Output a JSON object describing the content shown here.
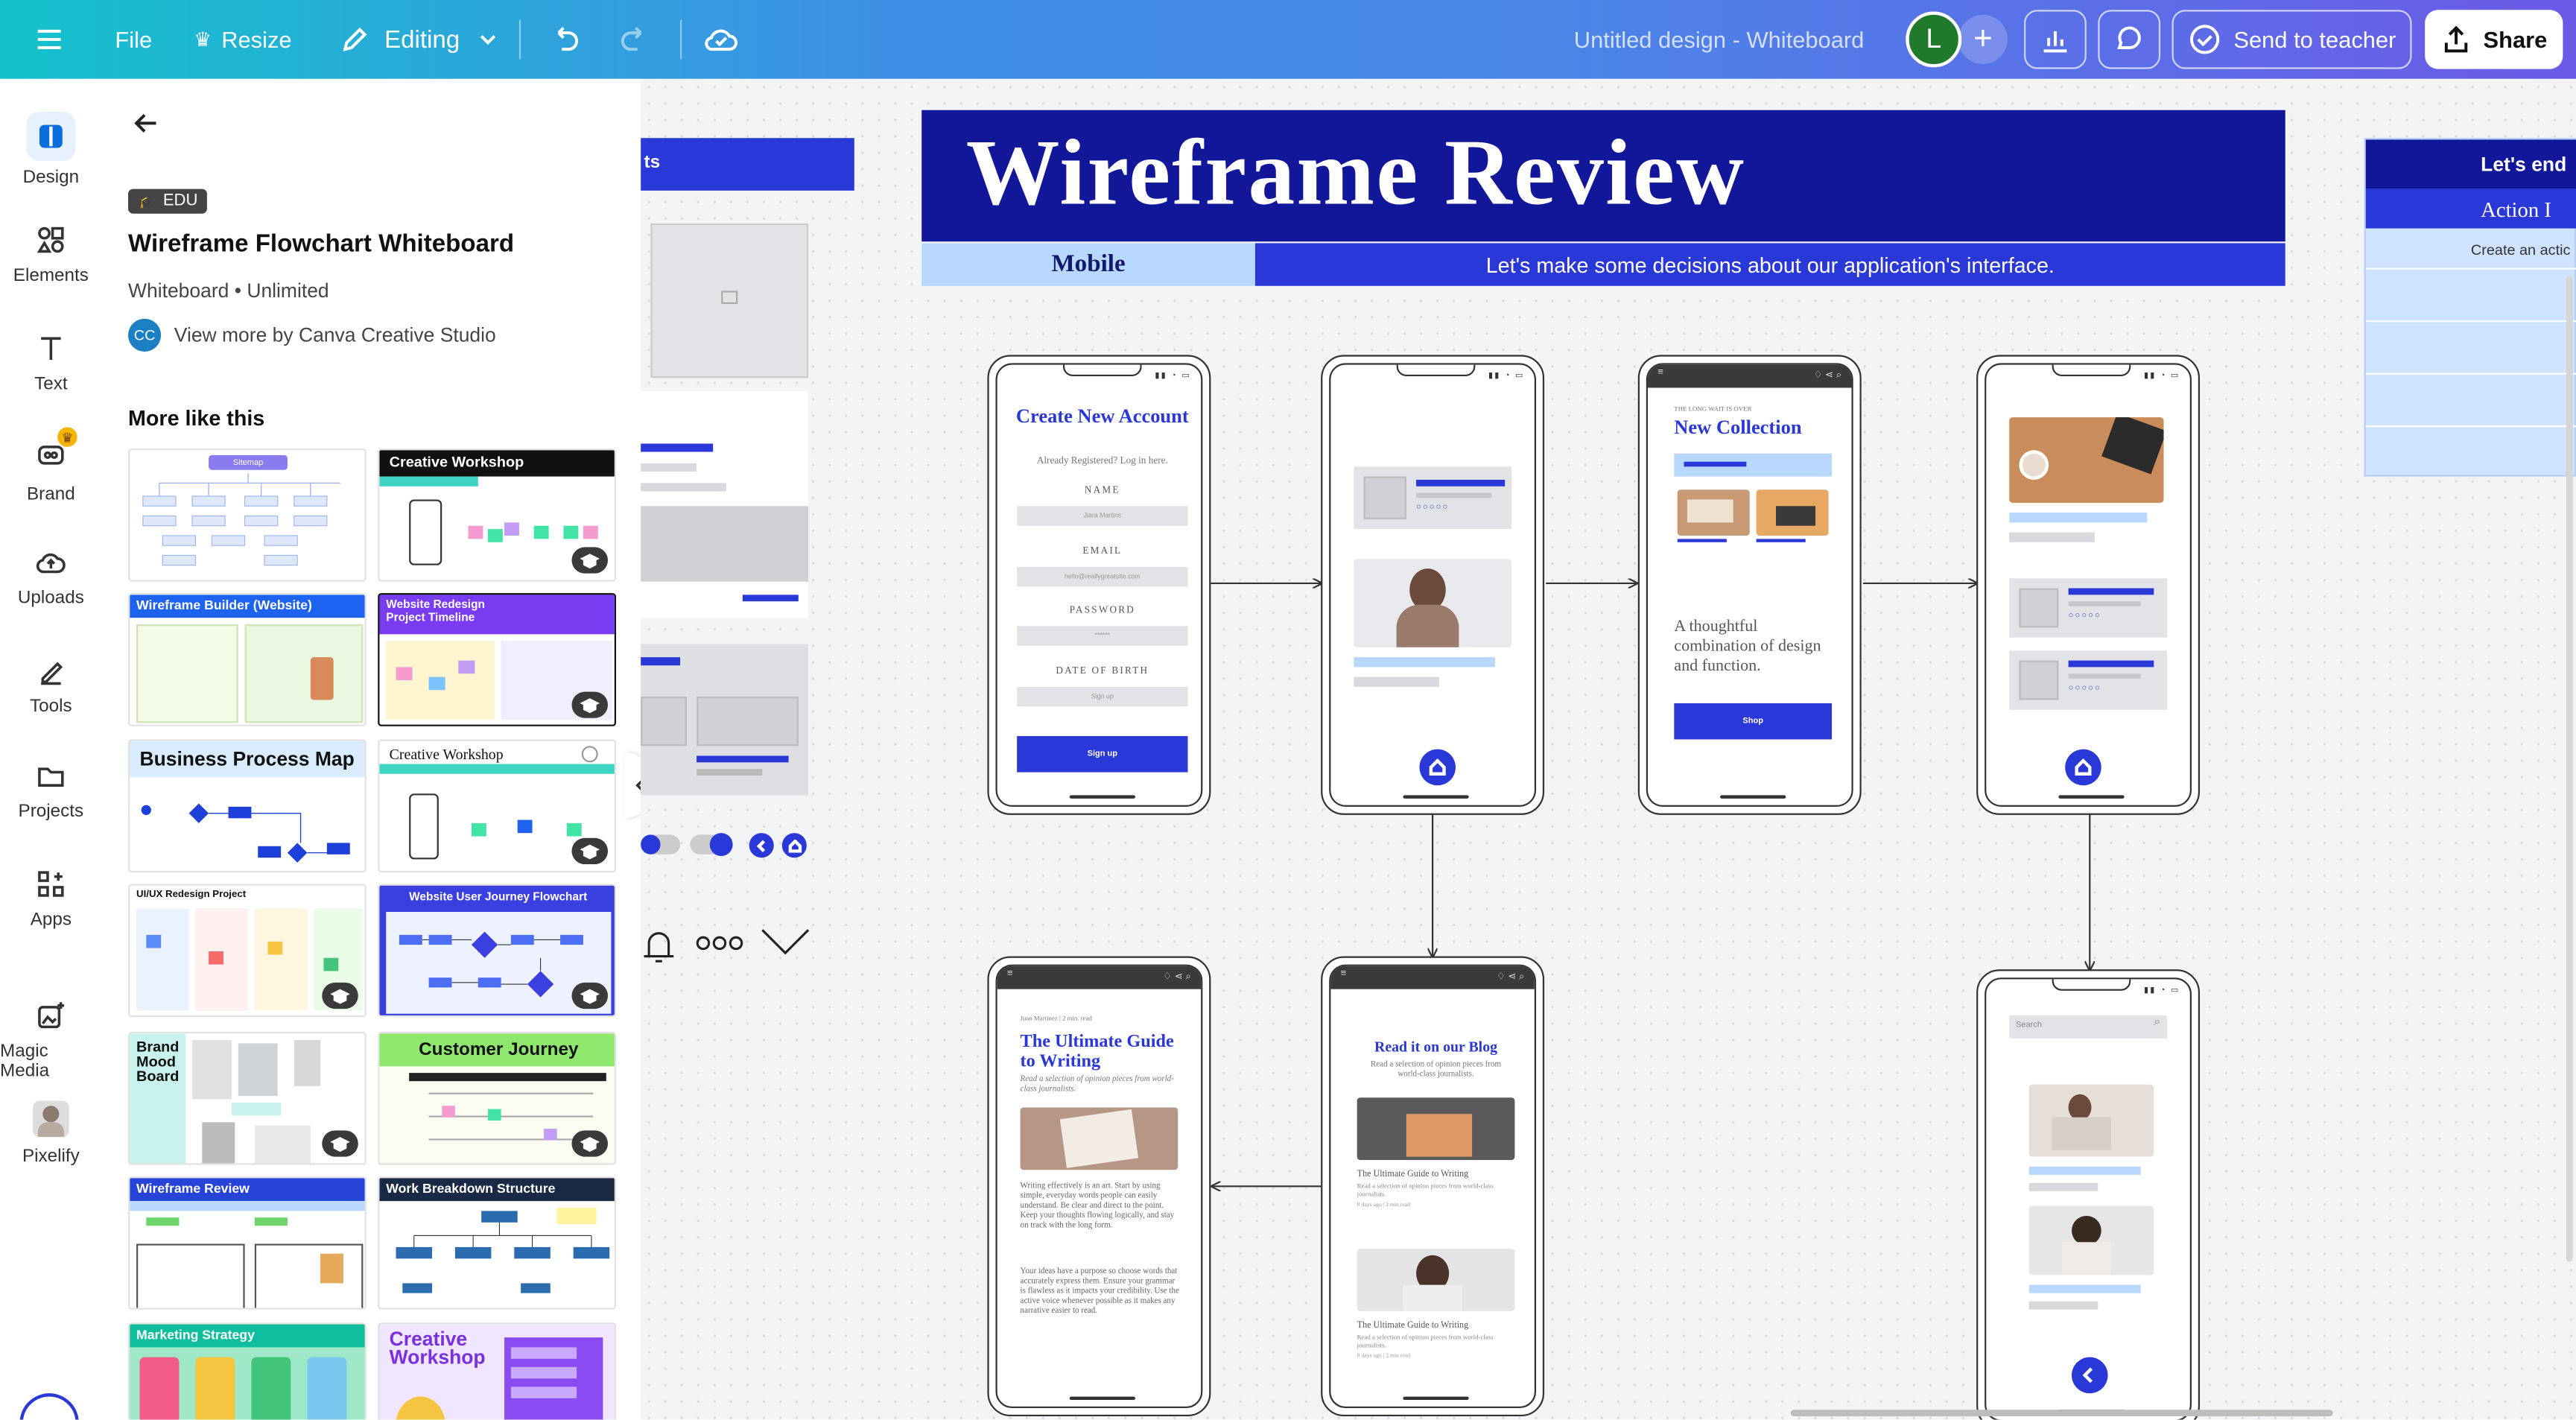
{
  "topbar": {
    "file": "File",
    "resize": "Resize",
    "editing": "Editing",
    "doc_title": "Untitled design - Whiteboard",
    "avatar_initial": "L",
    "send_to_teacher": "Send to teacher",
    "share": "Share"
  },
  "rail": [
    {
      "label": "Design",
      "icon": "design-icon"
    },
    {
      "label": "Elements",
      "icon": "elements-icon"
    },
    {
      "label": "Text",
      "icon": "text-icon"
    },
    {
      "label": "Brand",
      "icon": "brand-icon"
    },
    {
      "label": "Uploads",
      "icon": "uploads-icon"
    },
    {
      "label": "Tools",
      "icon": "tools-icon"
    },
    {
      "label": "Projects",
      "icon": "projects-icon"
    },
    {
      "label": "Apps",
      "icon": "apps-icon"
    },
    {
      "label": "Magic Media",
      "icon": "magic-media-icon"
    },
    {
      "label": "Pixelify",
      "icon": "pixelify-icon"
    }
  ],
  "panel": {
    "badge": "EDU",
    "title": "Wireframe Flowchart Whiteboard",
    "meta": "Whiteboard • Unlimited",
    "creator_initials": "CC",
    "creator_link": "View more by Canva Creative Studio",
    "section": "More like this",
    "thumbs": [
      {
        "label": "Sitemap"
      },
      {
        "label": "Creative Workshop"
      },
      {
        "label": "Wireframe Builder (Website)"
      },
      {
        "label": "Website Redesign Project Timeline"
      },
      {
        "label": "Business Process Map"
      },
      {
        "label": "Creative Workshop"
      },
      {
        "label": "UI/UX Redesign Project"
      },
      {
        "label": "Website User Journey Flowchart"
      },
      {
        "label": "Brand Mood Board"
      },
      {
        "label": "Customer Journey"
      },
      {
        "label": "Wireframe Review"
      },
      {
        "label": "Work Breakdown Structure"
      },
      {
        "label": "Marketing Strategy"
      },
      {
        "label": "Creative Workshop"
      }
    ]
  },
  "canvas": {
    "left_header": "ts",
    "right_header": "Let's end",
    "right_sub": "Action I",
    "right_row": "Create an actic",
    "banner_title": "Wireframe Review",
    "banner_tab": "Mobile",
    "banner_sub": "Let's make some decisions about our application's interface.",
    "phone1": {
      "title": "Create New Account",
      "sub": "Already Registered? Log in here.",
      "f1": "NAME",
      "p1": "Jiara Martins",
      "f2": "EMAIL",
      "p2": "hello@reallygreatsite.com",
      "f3": "PASSWORD",
      "p3": "******",
      "f4": "DATE OF BIRTH",
      "p4": "Sign up",
      "btn": "Sign up"
    },
    "phone3": {
      "kicker": "THE LONG WAIT IS OVER",
      "title": "New Collection",
      "body": "A thoughtful combination of design and function.",
      "btn": "Shop"
    },
    "phone5": {
      "kicker": "Juan Martinez | 2 min. read",
      "title": "The Ultimate Guide to Writing",
      "intro": "Read a selection of opinion pieces from world-class journalists.",
      "p1": "Writing effectively is an art. Start by using simple, everyday words people can easily understand. Be clear and direct to the point. Keep your thoughts flowing logically, and stay on track with the long form.",
      "p2": "Your ideas have a purpose so choose words that accurately express them. Ensure your grammar is flawless as it impacts your credibility. Use the active voice whenever possible as it makes any narrative easier to read."
    },
    "phone6": {
      "title": "Read it on our Blog",
      "sub": "Read a selection of opinion pieces from world-class journalists.",
      "a1": "The Ultimate Guide to Writing",
      "a1s": "Read a selection of opinion pieces from world-class journalists.",
      "a1m": "8 days ago | 2 min read",
      "a2": "The Ultimate Guide to Writing",
      "a2s": "Read a selection of opinion pieces from world-class journalists.",
      "a2m": "8 days ago | 2 min read"
    },
    "phone7": {
      "search": "Search"
    }
  },
  "colors": {
    "accent": "#2b38d8",
    "navy": "#12179a",
    "light": "#b9d8ff"
  }
}
